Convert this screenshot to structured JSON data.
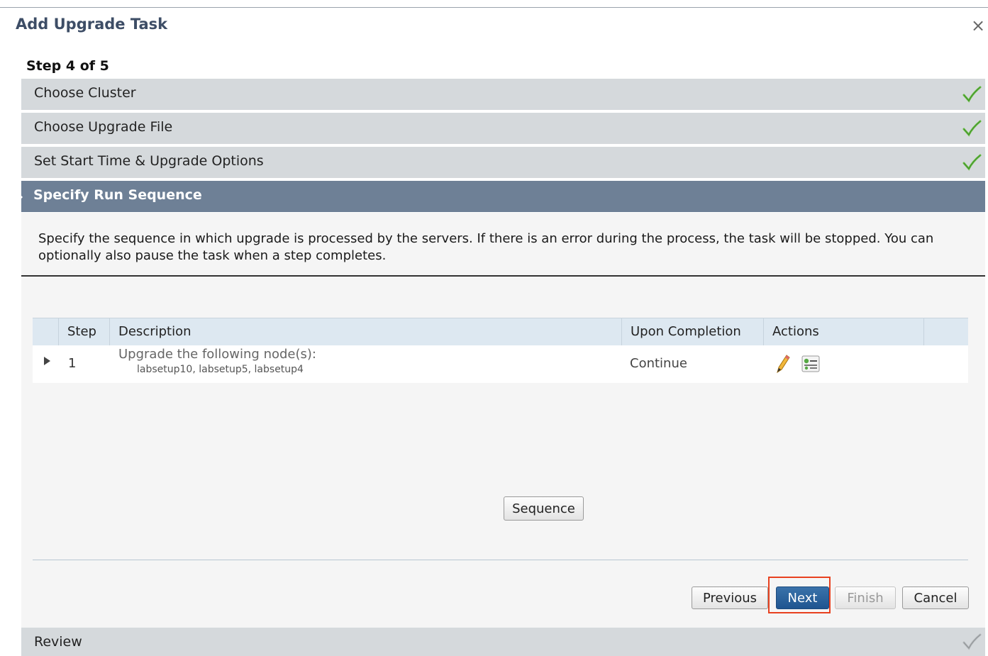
{
  "dialog": {
    "title": "Add Upgrade Task",
    "close_glyph": "×",
    "step_indicator": "Step 4 of 5"
  },
  "wizard_steps": [
    {
      "label": "Choose Cluster",
      "status": "complete",
      "icon": "check-icon"
    },
    {
      "label": "Choose Upgrade File",
      "status": "complete",
      "icon": "check-icon"
    },
    {
      "label": "Set Start Time & Upgrade Options",
      "status": "complete",
      "icon": "check-icon"
    },
    {
      "label": "Specify Run Sequence",
      "status": "active"
    },
    {
      "label": "Review",
      "status": "pending",
      "icon": "check-icon"
    }
  ],
  "panel": {
    "description": "Specify the sequence in which upgrade is processed by the servers. If there is an error during the process, the task will be stopped. You can optionally also pause the task when a step completes.",
    "table": {
      "columns": [
        "Step",
        "Description",
        "Upon Completion",
        "Actions"
      ],
      "rows": [
        {
          "step": "1",
          "description": "Upgrade the following node(s):",
          "nodes": "labsetup10, labsetup5, labsetup4",
          "upon_completion": "Continue",
          "actions": [
            "pencil-icon",
            "properties-icon"
          ]
        }
      ]
    },
    "sequence_button": "Sequence"
  },
  "footer": {
    "previous": "Previous",
    "next": "Next",
    "finish": "Finish",
    "cancel": "Cancel"
  },
  "colors": {
    "active_step_bg": "#6e8096",
    "step_bg": "#d5d9dc",
    "check_green": "#6cc04a",
    "primary_button": "#1f5590",
    "highlight_box": "#e8411f"
  }
}
